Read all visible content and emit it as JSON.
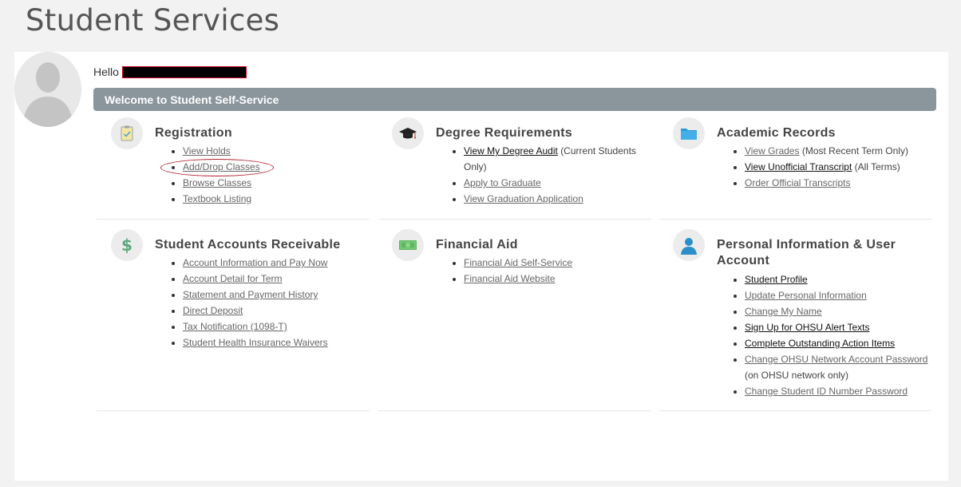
{
  "page_title": "Student Services",
  "greeting": "Hello",
  "welcome": "Welcome to Student Self-Service",
  "cards": {
    "registration": {
      "title": "Registration",
      "links": [
        "View Holds",
        "Add/Drop Classes",
        "Browse Classes",
        "Textbook Listing"
      ]
    },
    "degree": {
      "title": "Degree Requirements",
      "links": [
        "View My Degree Audit",
        "Apply to Graduate",
        "View Graduation Application"
      ],
      "audit_note": "(Current Students Only)"
    },
    "records": {
      "title": "Academic Records",
      "links": [
        "View Grades",
        "View Unofficial Transcript",
        "Order Official Transcripts"
      ],
      "grades_note": "(Most Recent Term Only)",
      "transcript_note": "(All Terms)"
    },
    "accounts": {
      "title": "Student Accounts Receivable",
      "links": [
        "Account Information and Pay Now",
        "Account Detail for Term",
        "Statement and Payment History",
        "Direct Deposit",
        "Tax Notification (1098-T)",
        "Student Health Insurance Waivers"
      ]
    },
    "aid": {
      "title": "Financial Aid",
      "links": [
        "Financial Aid Self-Service",
        "Financial Aid Website"
      ]
    },
    "personal": {
      "title": "Personal Information & User Account",
      "links": [
        "Student Profile",
        "Update Personal Information",
        "Change My Name",
        "Sign Up for OHSU Alert Texts",
        "Complete Outstanding Action Items",
        "Change OHSU Network Account Password",
        "Change Student ID Number Password"
      ],
      "password_note": "(on OHSU network only)"
    }
  },
  "icons": {
    "registration": "clipboard-icon",
    "degree": "graduation-cap-icon",
    "records": "folder-icon",
    "accounts": "dollar-icon",
    "aid": "money-icon",
    "personal": "user-icon"
  },
  "colors": {
    "welcome_bar": "#8a959c",
    "highlight_circle": "#b0202e",
    "folder_blue": "#2a9bd6",
    "money_green": "#5cb85c"
  }
}
